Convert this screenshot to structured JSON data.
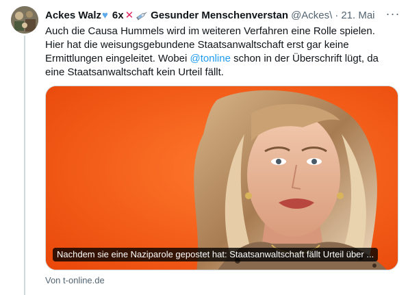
{
  "tweet": {
    "author_name": "Ackes Walz",
    "author_suffix": "6x",
    "author_suffix_end": "Gesunder Menschenverstan",
    "handle": "@Ackes\\",
    "date": "21. Mai",
    "more_label": "···",
    "text_part1": "Auch die Causa Hummels wird im weiteren Verfahren eine Rolle spielen. Hier hat die weisungsgebundene Staatsanwaltschaft erst gar keine Ermittlungen eingeleitet. Wobei ",
    "mention": "@tonline",
    "text_part2": " schon in der Überschrift lügt, da eine Staatsanwaltschaft kein Urteil fällt."
  },
  "link_card": {
    "title": "Nachdem sie eine Naziparole gepostet hat: Staatsanwaltschaft fällt Urteil über ...",
    "source": "Von t-online.de"
  },
  "colors": {
    "link_blue": "#1d9bf0",
    "secondary_text": "#536471",
    "card_background": "#f05a13"
  },
  "icons": [
    "blue-heart-icon",
    "red-cross-icon",
    "syringe-icon",
    "more-icon"
  ]
}
